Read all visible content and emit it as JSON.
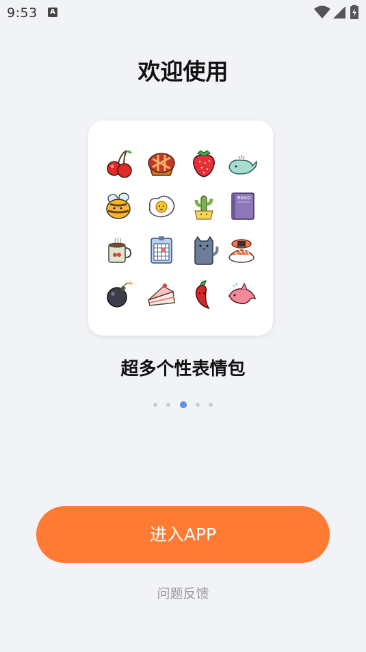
{
  "status_bar": {
    "time": "9:53",
    "notification_icon": "a-icon",
    "icons": [
      "wifi-icon",
      "signal-icon",
      "battery-icon"
    ]
  },
  "title": "欢迎使用",
  "sticker_grid": {
    "stickers": [
      "cherry-icon",
      "pie-icon",
      "strawberry-icon",
      "whale-icon",
      "bee-icon",
      "fried-egg-icon",
      "cactus-icon",
      "book-icon",
      "coffee-mug-icon",
      "calendar-icon",
      "cat-icon",
      "sushi-icon",
      "bomb-icon",
      "cake-slice-icon",
      "chili-pepper-icon",
      "dolphin-icon"
    ],
    "book_label": "READ"
  },
  "caption": "超多个性表情包",
  "pager": {
    "count": 5,
    "active_index": 2
  },
  "primary_button": {
    "label": "进入APP",
    "color": "#ff7a32"
  },
  "feedback_link": "问题反馈",
  "colors": {
    "background": "#f1f3f7",
    "accent": "#ff7a32",
    "pager_active": "#5e8ff0"
  }
}
